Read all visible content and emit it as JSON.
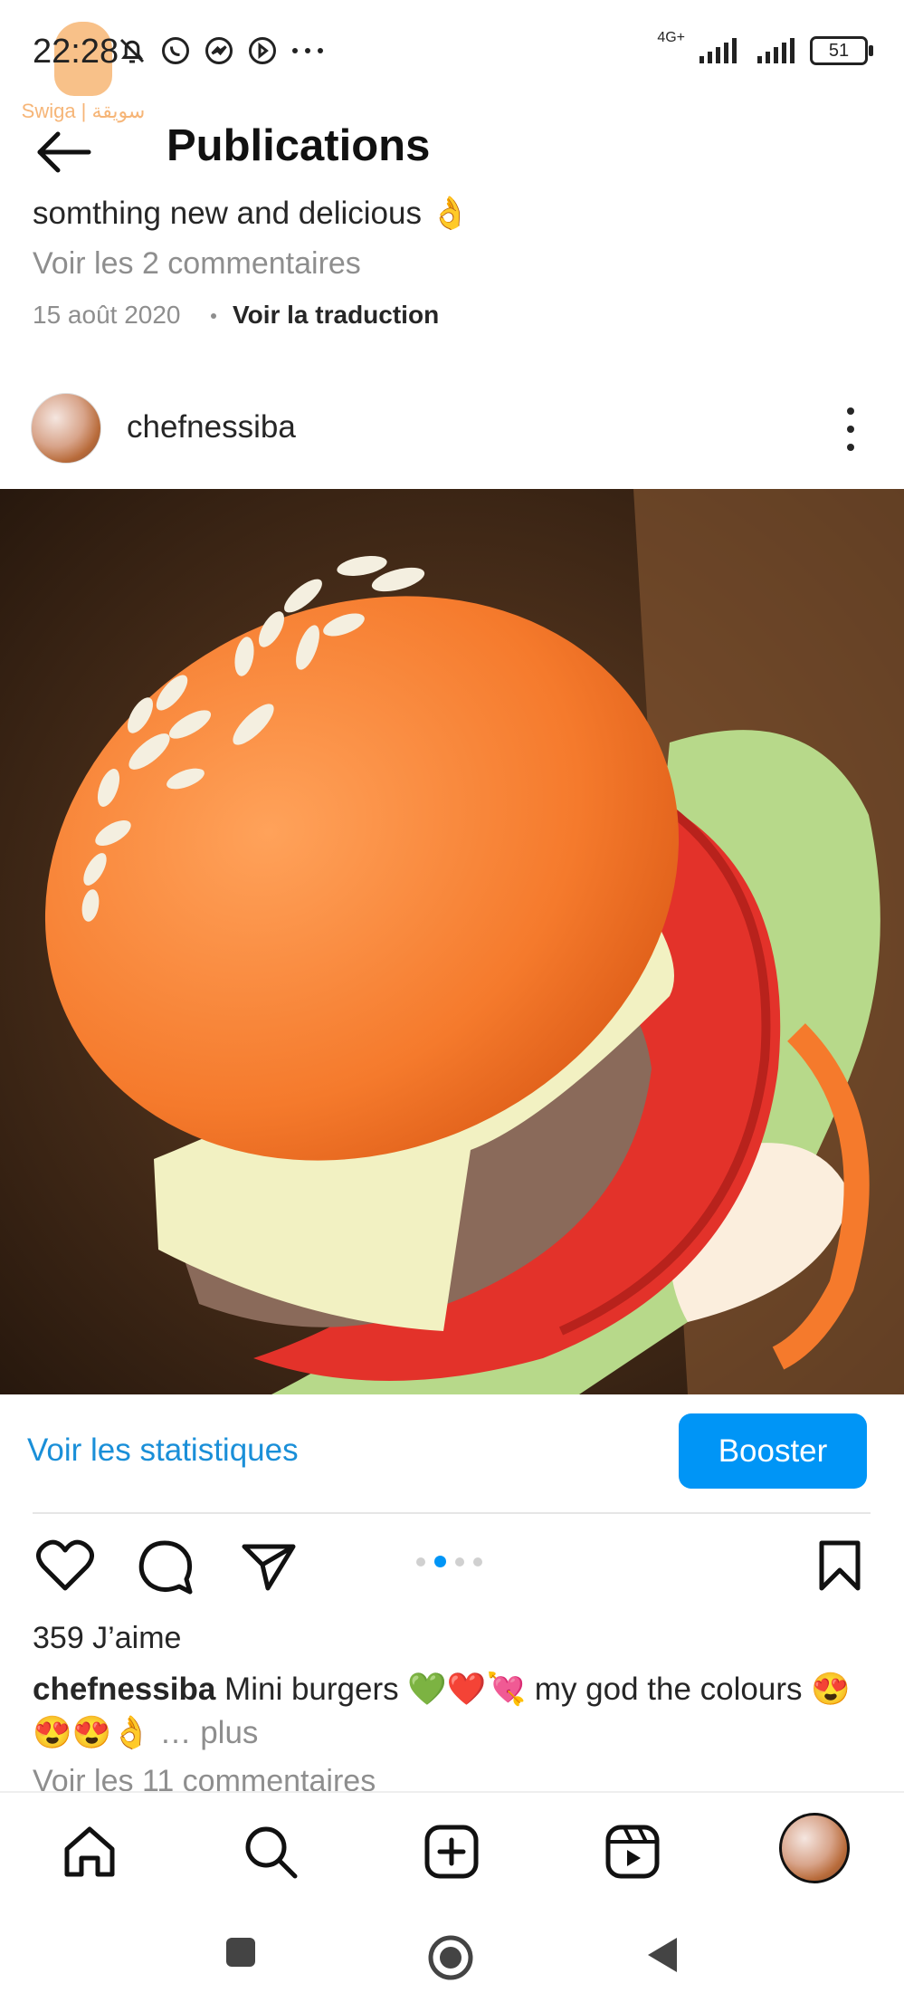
{
  "status_bar": {
    "time": "22:28",
    "network": "4G+",
    "battery": "51",
    "notification_icons": [
      "bell-off-icon",
      "whatsapp-icon",
      "messenger-icon",
      "navigation-icon",
      "more-dots-icon"
    ]
  },
  "watermark": {
    "text": "Swiga | سويقة"
  },
  "header": {
    "title": "Publications"
  },
  "previous_post": {
    "caption_tail": "somthing new and delicious 👌",
    "comments_link": "Voir les 2 commentaires",
    "date": "15 août 2020",
    "translate": "Voir la traduction"
  },
  "post": {
    "username": "chefnessiba",
    "stats_link": "Voir les statistiques",
    "boost_label": "Booster",
    "likes": "359 J’aime",
    "caption_user": "chefnessiba",
    "caption_text": "Mini burgers 💚❤️💘 my god the colours 😍 😍😍👌",
    "caption_more": "… plus",
    "comments_link": "Voir les 11 commentaires",
    "carousel": {
      "count": 4,
      "active": 2
    }
  },
  "colors": {
    "accent": "#0095f6",
    "link": "#1a8fd8",
    "muted": "#8e8e8e"
  }
}
